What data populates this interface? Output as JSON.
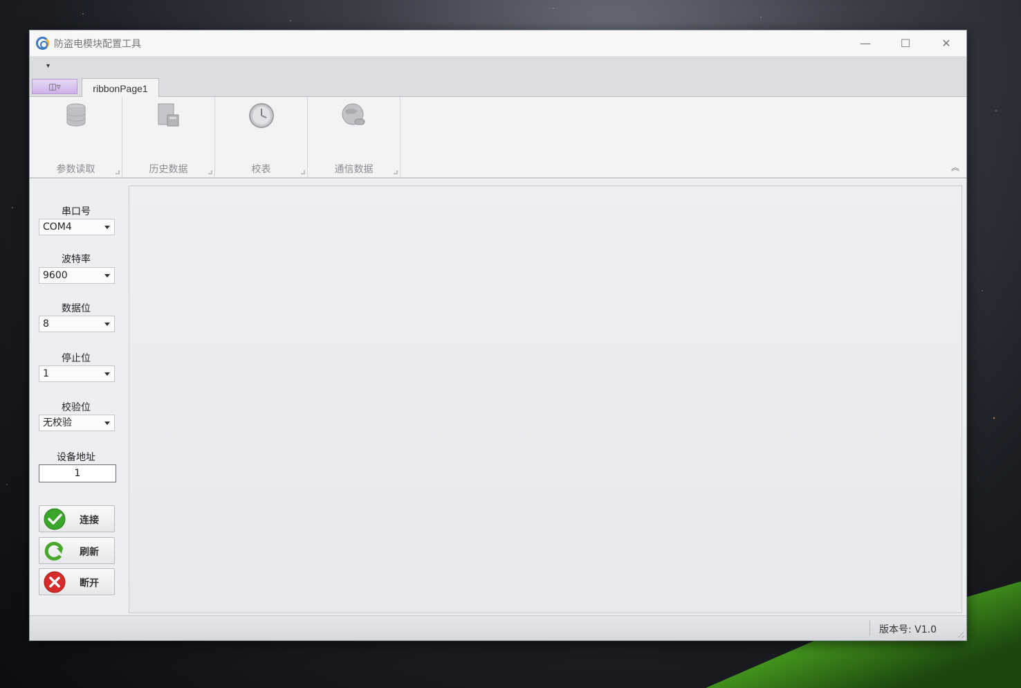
{
  "window": {
    "title": "防盗电模块配置工具",
    "minimize": "—",
    "maximize": "☐",
    "close": "✕"
  },
  "ribbon": {
    "qat_dropdown": "▾",
    "app_menu": "◫▿",
    "tabs": [
      {
        "label": "ribbonPage1"
      }
    ],
    "groups": [
      {
        "label": "参数读取",
        "icon": "database-icon"
      },
      {
        "label": "历史数据",
        "icon": "history-data-icon"
      },
      {
        "label": "校表",
        "icon": "clock-icon"
      },
      {
        "label": "通信数据",
        "icon": "globe-network-icon"
      }
    ],
    "collapse": "︽"
  },
  "settings": {
    "port_label": "串口号",
    "port_value": "COM4",
    "baud_label": "波特率",
    "baud_value": "9600",
    "databits_label": "数据位",
    "databits_value": "8",
    "stopbits_label": "停止位",
    "stopbits_value": "1",
    "parity_label": "校验位",
    "parity_value": "无校验",
    "address_label": "设备地址",
    "address_value": "1"
  },
  "buttons": {
    "connect": "连接",
    "refresh": "刷新",
    "disconnect": "断开"
  },
  "status": {
    "version": "版本号: V1.0"
  },
  "colors": {
    "accent_purple": "#cdb0ea",
    "ok_green": "#3aa52a",
    "error_red": "#d62b2b"
  }
}
